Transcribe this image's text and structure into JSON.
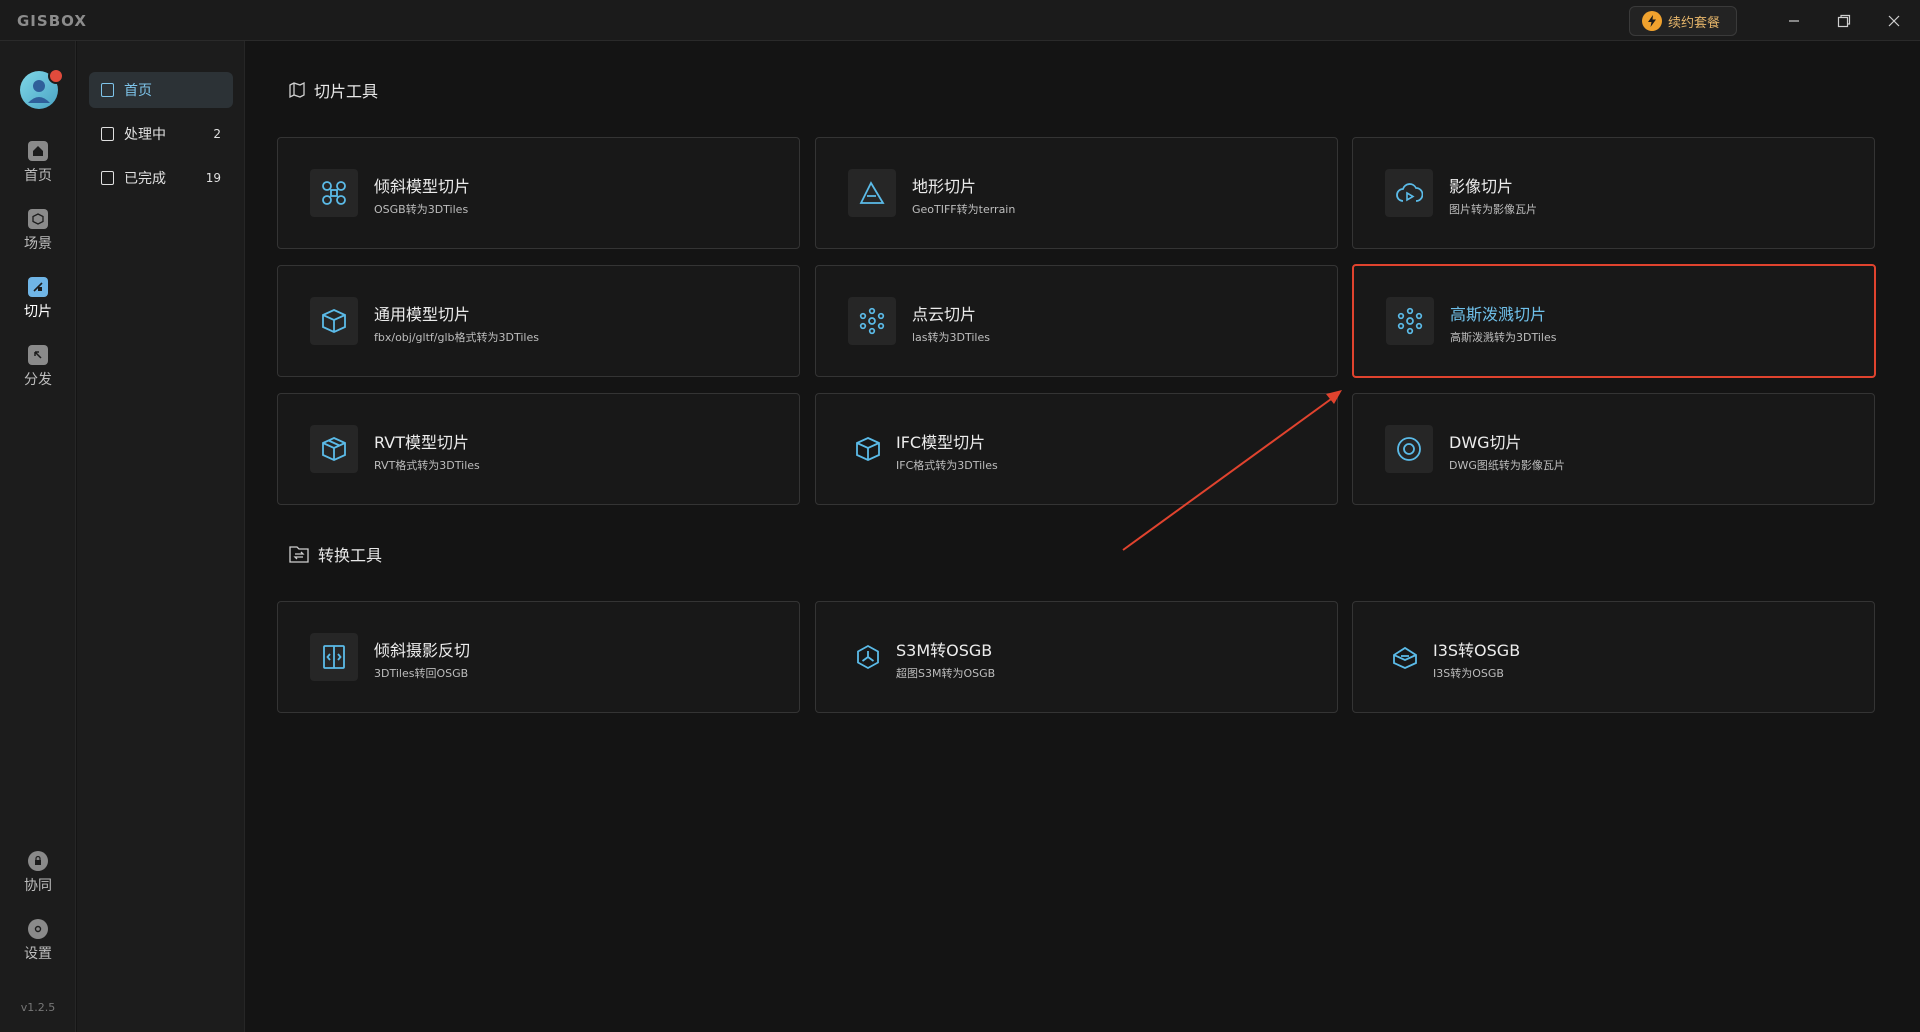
{
  "app": {
    "logo": "GISBOX",
    "version": "v1.2.5"
  },
  "titlebar": {
    "renew_label": "续约套餐"
  },
  "rail": [
    {
      "label": "首页",
      "icon": "home-icon"
    },
    {
      "label": "场景",
      "icon": "cube-icon"
    },
    {
      "label": "切片",
      "icon": "slice-icon",
      "active": true
    },
    {
      "label": "分发",
      "icon": "share-icon"
    },
    {
      "label": "协同",
      "icon": "lock-icon"
    },
    {
      "label": "设置",
      "icon": "gear-icon"
    }
  ],
  "subnav": [
    {
      "label": "首页",
      "count": "",
      "active": true
    },
    {
      "label": "处理中",
      "count": "2"
    },
    {
      "label": "已完成",
      "count": "19"
    }
  ],
  "sections": {
    "slice": {
      "title": "切片工具",
      "cards": [
        {
          "title": "倾斜模型切片",
          "subtitle": "OSGB转为3DTiles",
          "icon": "drone-icon"
        },
        {
          "title": "地形切片",
          "subtitle": "GeoTIFF转为terrain",
          "icon": "terrain-icon"
        },
        {
          "title": "影像切片",
          "subtitle": "图片转为影像瓦片",
          "icon": "cloud-play-icon"
        },
        {
          "title": "通用模型切片",
          "subtitle": "fbx/obj/gltf/glb格式转为3DTiles",
          "icon": "box-icon"
        },
        {
          "title": "点云切片",
          "subtitle": "las转为3DTiles",
          "icon": "point-cloud-icon"
        },
        {
          "title": "高斯泼溅切片",
          "subtitle": "高斯泼溅转为3DTiles",
          "icon": "gaussian-icon",
          "highlighted": true
        },
        {
          "title": "RVT模型切片",
          "subtitle": "RVT格式转为3DTiles",
          "icon": "rvt-icon"
        },
        {
          "title": "IFC模型切片",
          "subtitle": "IFC格式转为3DTiles",
          "icon": "ifc-icon"
        },
        {
          "title": "DWG切片",
          "subtitle": "DWG图纸转为影像瓦片",
          "icon": "dwg-icon"
        }
      ]
    },
    "convert": {
      "title": "转换工具",
      "cards": [
        {
          "title": "倾斜摄影反切",
          "subtitle": "3DTiles转回OSGB",
          "icon": "reverse-icon"
        },
        {
          "title": "S3M转OSGB",
          "subtitle": "超图S3M转为OSGB",
          "icon": "s3m-icon"
        },
        {
          "title": "I3S转OSGB",
          "subtitle": "I3S转为OSGB",
          "icon": "i3s-icon"
        }
      ]
    }
  },
  "colors": {
    "accent": "#6fc0ea",
    "highlight": "#e0432e",
    "background": "#141414"
  }
}
